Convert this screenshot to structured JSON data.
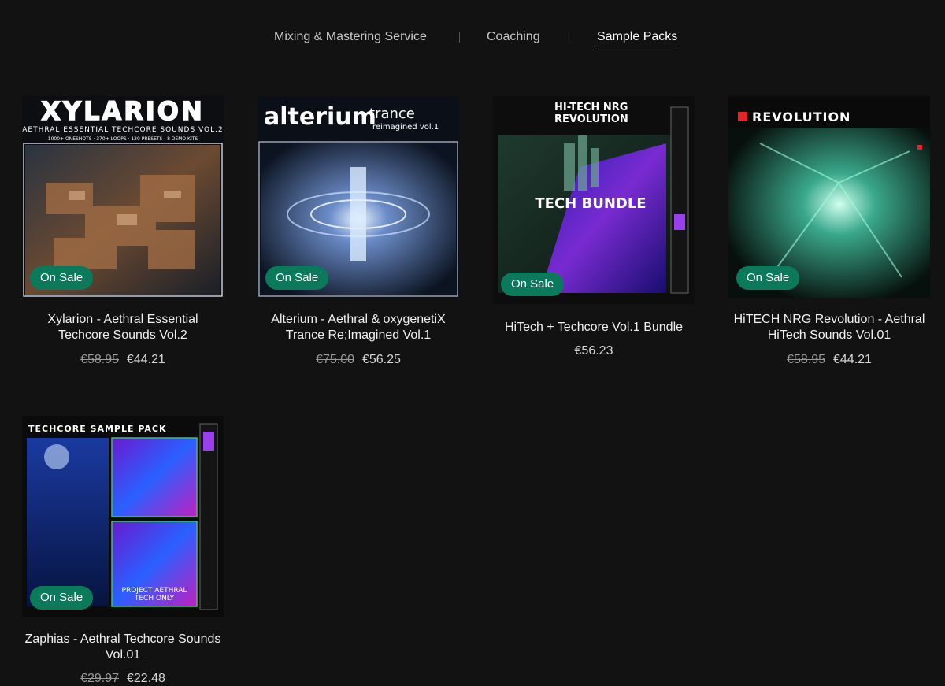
{
  "nav": {
    "items": [
      {
        "label": "Mixing & Mastering Service",
        "active": false
      },
      {
        "label": "Coaching",
        "active": false
      },
      {
        "label": "Sample Packs",
        "active": true
      }
    ]
  },
  "colors": {
    "background": "#121212",
    "badge": "#0b7a5a",
    "text": "#f0f0f0",
    "muted": "#9a9a9a"
  },
  "products": [
    {
      "title": "Xylarion - Aethral Essential Techcore Sounds Vol.2",
      "badge": "On Sale",
      "old_price": "€58.95",
      "price": "€44.21",
      "art": {
        "heading": "XYLARION",
        "sub": "AETHRAL ESSENTIAL TECHCORE SOUNDS VOL.2",
        "stats": "1000+ ONESHOTS · 370+ LOOPS · 120 PRESETS · 8 DEMO KITS"
      }
    },
    {
      "title": "Alterium - Aethral & oxygenetiX Trance Re;Imagined Vol.1",
      "badge": "On Sale",
      "old_price": "€75.00",
      "price": "€56.25",
      "art": {
        "heading": "alterium",
        "sub": "trance",
        "stats": "reimagined vol.1"
      }
    },
    {
      "title": "HiTech + Techcore Vol.1 Bundle",
      "badge": "On Sale",
      "old_price": "",
      "price": "€56.23",
      "art": {
        "heading": "HI-TECH NRG",
        "sub": "REVOLUTION",
        "stats": "TECH BUNDLE"
      }
    },
    {
      "title": "HiTECH NRG Revolution - Aethral HiTech Sounds Vol.01",
      "badge": "On Sale",
      "old_price": "€58.95",
      "price": "€44.21",
      "art": {
        "heading": "REVOLUTION",
        "sub": "",
        "stats": ""
      }
    },
    {
      "title": "Zaphias - Aethral Techcore Sounds Vol.01",
      "badge": "On Sale",
      "old_price": "€29.97",
      "price": "€22.48",
      "art": {
        "heading": "TECHCORE SAMPLE PACK",
        "sub": "PROJECT AETHRAL",
        "stats": "TECH ONLY"
      }
    }
  ]
}
